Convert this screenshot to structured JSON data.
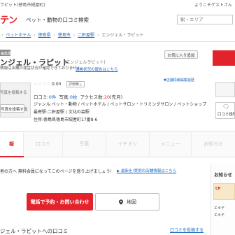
{
  "top_strip": {
    "crumb": "ラピット(徳島市紺屋町)",
    "welcome": "ようこそゲストさん"
  },
  "header": {
    "logo": "エキテン",
    "logo_visible": "テン",
    "site_name": "ペット・動物の口コミ検索",
    "search_placeholder": "駅・エリア"
  },
  "breadcrumb": [
    {
      "label": "ペットホテル",
      "link": true
    },
    {
      "label": "徳島県",
      "link": true
    },
    {
      "label": "徳島市",
      "link": true
    },
    {
      "label": "二軒屋駅",
      "link": true
    },
    {
      "label": "エンジェル・ラピット",
      "link": false
    }
  ],
  "shop": {
    "category_tag": "編集履歴",
    "name": "ンジェル・ラピット",
    "kana": "(エンジェルラピット)",
    "notice": "情報は店舗の運営状況が確認できておりません。",
    "notice_link": "運営状況の報告はこちら",
    "favorite_button": "お気に入り追加",
    "edit_link": "▼店舗情報編集履歴",
    "photo_text": "写真を投稿する",
    "photo_button": "写真を投稿する",
    "stars": "☆☆☆☆☆",
    "score": "0.00",
    "unrated": "評価無し",
    "stats": {
      "review_label": "口コミ:",
      "review_count": "0件",
      "photo_label": "写真:",
      "photo_count": "0枚",
      "access_label": "アクセス数:",
      "access_count": "20",
      "access_unit": "(先月)"
    },
    "genre": "ジャンル:ペット・動物 / ペットホテル / ペットサロン・トリミングサロン / ペットショップ",
    "station": "最寄駅:二軒屋駅 / 文化の森駅",
    "address": "住所:徳島県徳島市紺屋町17番8-6",
    "review_button": "口コミ投稿"
  },
  "tabs": [
    {
      "label": "報",
      "active": true
    },
    {
      "label": "口コミ",
      "active": false
    },
    {
      "label": "写真",
      "active": false
    },
    {
      "label": "イチオシ",
      "active": false
    },
    {
      "label": "メニュー",
      "active": false
    },
    {
      "label": "お知らせ",
      "active": false
    }
  ],
  "owner": {
    "text": "者の方へ 無料会員になってこのページを盛り上げましょう!",
    "link": "▶ 最新を!実例の店舗情報はこちら"
  },
  "cta": {
    "tel_label": "電話で予約・お問い合わせ",
    "map_label": "地図"
  },
  "bottom": {
    "title": "ジェル・ラピットへの口コミ",
    "link": "口コミを投稿する"
  },
  "sidebar": {
    "title": "お知らせ",
    "thumb_text": "CP",
    "bullet1": "エキテ",
    "bullet2": "エキテ"
  },
  "colors": {
    "brand_red": "#e3232b",
    "link_blue": "#1a6cc5"
  }
}
